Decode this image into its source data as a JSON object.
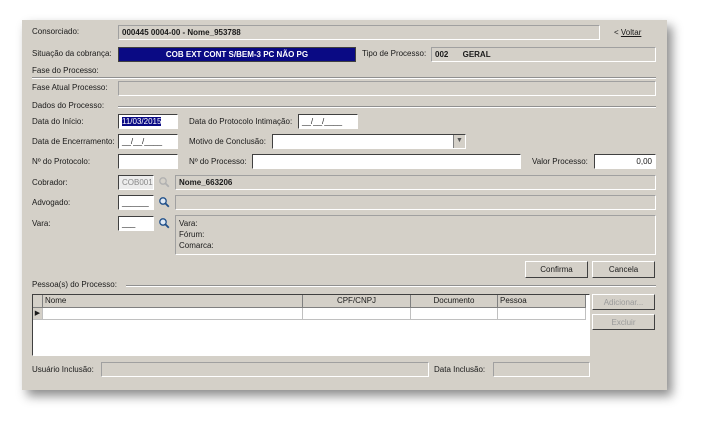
{
  "header": {
    "consorciado_label": "Consorciado:",
    "consorciado_value": "000445 0004-00 - Nome_953788",
    "voltar_label": "Voltar",
    "situacao_label": "Situação da cobrança:",
    "situacao_value": "COB EXT CONT S/BEM-3 PC NÃO PG",
    "tipo_label": "Tipo de Processo:",
    "tipo_code": "002",
    "tipo_value": "GERAL"
  },
  "fase": {
    "section_label": "Fase do Processo:",
    "atual_label": "Fase Atual Processo:",
    "atual_value": ""
  },
  "dados": {
    "section_label": "Dados do Processo:",
    "data_inicio_label": "Data do Início:",
    "data_inicio_value": "11/03/2015",
    "data_protocolo_label": "Data do Protocolo Intimação:",
    "data_protocolo_value": "__/__/____",
    "data_encerramento_label": "Data de Encerramento:",
    "data_encerramento_value": "__/__/____",
    "motivo_label": "Motivo de Conclusão:",
    "motivo_value": "",
    "protocolo_label": "Nº do Protocolo:",
    "protocolo_value": "",
    "processo_label": "Nº do Processo:",
    "processo_value": "",
    "valor_label": "Valor Processo:",
    "valor_value": "0,00",
    "cobrador_label": "Cobrador:",
    "cobrador_code": "COB001",
    "cobrador_name": "Nome_663206",
    "advogado_label": "Advogado:",
    "advogado_code": "______",
    "advogado_name": "",
    "vara_label": "Vara:",
    "vara_code": "___",
    "vara_detail_vara": "Vara:",
    "vara_detail_forum": "Fórum:",
    "vara_detail_comarca": "Comarca:"
  },
  "actions": {
    "confirma": "Confirma",
    "cancela": "Cancela",
    "adicionar": "Adicionar...",
    "excluir": "Excluir"
  },
  "pessoas": {
    "section_label": "Pessoa(s) do Processo:",
    "columns": [
      "Nome",
      "CPF/CNPJ",
      "Documento",
      "Pessoa"
    ],
    "row_marker": "▶"
  },
  "footer": {
    "usuario_label": "Usuário Inclusão:",
    "usuario_value": "",
    "data_label": "Data Inclusão:",
    "data_value": ""
  },
  "colors": {
    "window_bg": "#d4d0c8",
    "selected_bg": "#0a0a84",
    "selected_text": "#ffffff"
  },
  "icons": {
    "voltar": "chevron-left-icon",
    "lookup": "magnifier-icon",
    "dropdown": "chevron-down-icon"
  }
}
